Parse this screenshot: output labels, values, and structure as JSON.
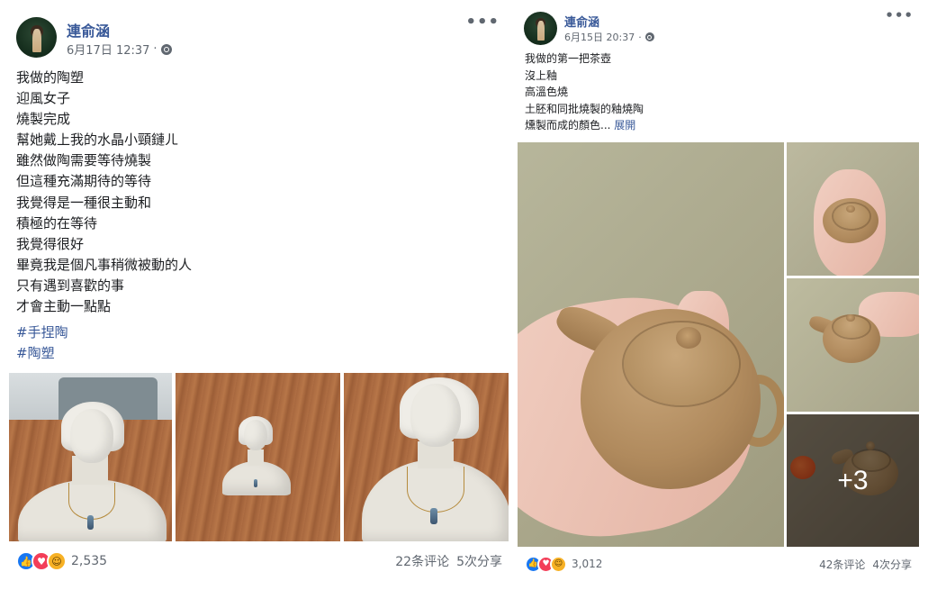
{
  "posts": [
    {
      "author": "連俞涵",
      "date": "6月17日 12:37",
      "separator": "·",
      "more_label": "•••",
      "lines": [
        "我做的陶塑",
        "迎風女子",
        "燒製完成",
        "幫她戴上我的水晶小頸鏈ㄦ",
        "雖然做陶需要等待燒製",
        "但這種充滿期待的等待",
        "我覺得是一種很主動和",
        "積極的在等待",
        "我覺得很好",
        "畢竟我是個凡事稍微被動的人",
        "只有遇到喜歡的事",
        "才會主動一點點"
      ],
      "hashtags": [
        "#手捏陶",
        "#陶塑"
      ],
      "reaction_count": "2,535",
      "comments": "22条评论",
      "shares": "5次分享"
    },
    {
      "author": "連俞涵",
      "date": "6月15日 20:37",
      "separator": "·",
      "more_label": "•••",
      "lines": [
        "我做的第一把茶壺",
        "沒上釉",
        "高溫色燒",
        "土胚和同批燒製的釉燒陶"
      ],
      "last_line": "燻製而成的顏色...",
      "see_more": "展開",
      "extra_photos": "+3",
      "reaction_count": "3,012",
      "comments": "42条评论",
      "shares": "4次分享"
    }
  ],
  "icons": {
    "reactions1": [
      "like-icon",
      "love-icon",
      "haha-icon"
    ],
    "reactions2": [
      "like-icon",
      "love-icon",
      "wow-icon"
    ]
  },
  "colors": {
    "link": "#385898",
    "meta": "#606770",
    "like": "#1877f2",
    "love": "#f33e58"
  }
}
